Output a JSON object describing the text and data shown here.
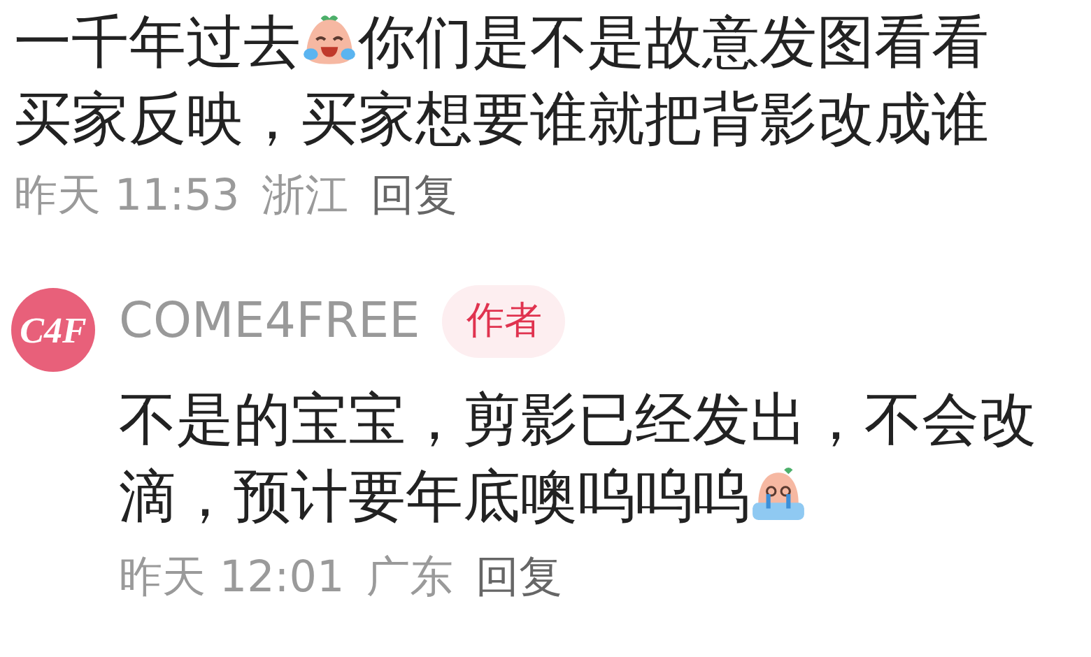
{
  "comment": {
    "body": [
      {
        "kind": "text",
        "text": "一千年过去"
      },
      {
        "kind": "laugh"
      },
      {
        "kind": "text",
        "text": "你们是不是故意发图看看买家反映，买家想要谁就把背影改成谁"
      }
    ],
    "time": "昨天 11:53",
    "location": "浙江",
    "reply_label": "回复"
  },
  "reply": {
    "avatar_text": "C4F",
    "author": "COME4FREE",
    "badge": "作者",
    "body": [
      {
        "kind": "text",
        "text": "不是的宝宝，剪影已经发出，不会改滴，预计要年底噢呜呜呜"
      },
      {
        "kind": "sob"
      }
    ],
    "time": "昨天 12:01",
    "location": "广东",
    "reply_label": "回复"
  }
}
